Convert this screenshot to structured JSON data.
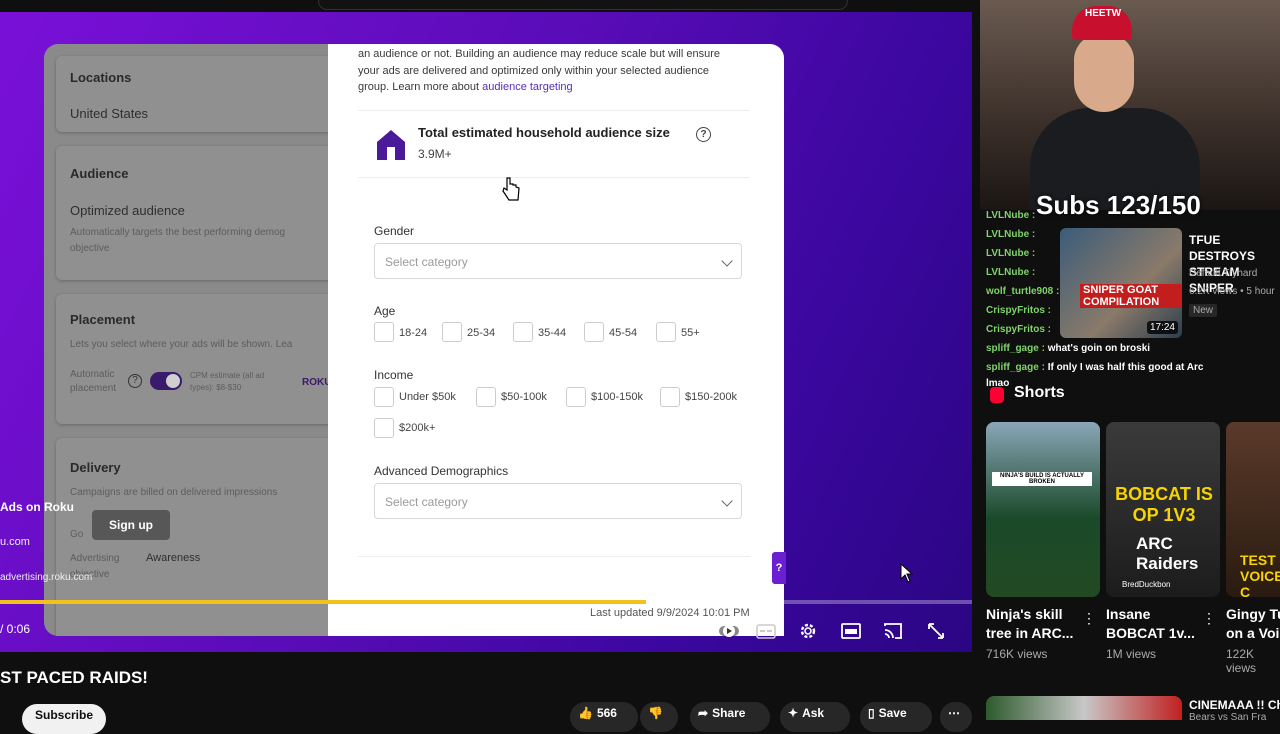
{
  "player": {
    "left_panel": {
      "locations_heading": "Locations",
      "locations_value": "United States",
      "audience_heading": "Audience",
      "audience_value": "Optimized audience",
      "audience_desc": "Automatically targets the best performing demog",
      "audience_desc2": "objective",
      "placement_heading": "Placement",
      "placement_desc": "Lets you select where your ads will be shown. Lea",
      "placement_auto": "Automatic",
      "placement_auto2": "placement",
      "cpm_estimate": "CPM estimate (all ad",
      "cpm_estimate2": "types): $8-$30",
      "roku_logo": "ROKU",
      "delivery_heading": "Delivery",
      "delivery_desc": "Campaigns are billed on delivered impressions",
      "goal_label": "Go",
      "advertising_objective": "Advertising",
      "advertising_objective2": "objective",
      "awareness_value": "Awareness"
    },
    "ad_overlay": {
      "title": "Ads on Roku",
      "domain": "u.com",
      "url": "advertising.roku.com",
      "signup_label": "Sign up"
    },
    "modal": {
      "intro_line1": "an audience or not. Building an audience may reduce scale but will ensure",
      "intro_line2": "your ads are delivered and optimized only within your selected audience",
      "intro_line3": "group. Learn more about",
      "intro_link": "audience targeting",
      "household_title": "Total estimated household audience size",
      "household_help": "?",
      "household_size": "3.9M+",
      "gender_label": "Gender",
      "gender_placeholder": "Select category",
      "age_label": "Age",
      "age_options": [
        "18-24",
        "25-34",
        "35-44",
        "45-54",
        "55+"
      ],
      "income_label": "Income",
      "income_options": [
        "Under $50k",
        "$50-100k",
        "$100-150k",
        "$150-200k",
        "$200k+"
      ],
      "advanced_label": "Advanced Demographics",
      "advanced_placeholder": "Select category",
      "last_updated": "Last updated 9/9/2024 10:01 PM",
      "help_tab": "?"
    },
    "progress": 0.665,
    "time": "/ 0:06"
  },
  "webcam": {
    "cap_text": "HEETW",
    "subs_counter": "Subs 123/150",
    "chat": [
      {
        "user": "LVLNube :",
        "msg": ""
      },
      {
        "user": "LVLNube :",
        "msg": ""
      },
      {
        "user": "LVLNube :",
        "msg": ""
      },
      {
        "user": "LVLNube :",
        "msg": ""
      },
      {
        "user": "wolf_turtle908 :",
        "msg": ""
      },
      {
        "user": "CrispyFritos :",
        "msg": ""
      },
      {
        "user": "CrispyFritos :",
        "msg": ""
      },
      {
        "user": "spliff_gage :",
        "msg": "what's goin on broski"
      },
      {
        "user": "spliff_gage :",
        "msg": "If only I was half this good at Arc"
      },
      {
        "user": "",
        "msg": "lmao"
      }
    ]
  },
  "recommended": {
    "thumb_label": "SNIPER GOAT COMPILATION",
    "duration": "17:24",
    "title": "TFUE DESTROYS STREAM SNIPER",
    "channel": "Default Tryhard",
    "views": "6.2K views • 5 hour",
    "badge": "New"
  },
  "shorts": {
    "heading": "Shorts",
    "items": [
      {
        "title": "Ninja's skill tree in ARC...",
        "views": "716K views",
        "overlay": "NINJA'S BUILD IS ACTUALLY BROKEN"
      },
      {
        "title": "Insane BOBCAT 1v...",
        "views": "1M views",
        "overlay": "BOBCAT IS OP 1V3",
        "overlay2": "ARC Raiders",
        "overlay3": "BredDuckbon"
      },
      {
        "title": "Gingy Tu on a Voi",
        "views": "122K views",
        "overlay": "TEST VOICE C"
      }
    ]
  },
  "below": {
    "video_title": "ST PACED RAIDS!",
    "subscribe": "Subscribe",
    "like_count": "566",
    "share": "Share",
    "ask": "Ask",
    "save": "Save",
    "more": "⋯"
  },
  "bottom_rec": {
    "title": "CINEMAAA !! Ch",
    "sub": "Bears vs San Fra"
  },
  "colors": {
    "brand_purple": "#6a1fd0",
    "progress_yellow": "#f3c11e"
  }
}
